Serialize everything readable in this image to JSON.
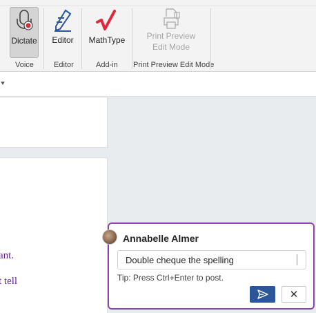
{
  "ribbon": {
    "buttons": {
      "dictate": "Dictate",
      "editor": "Editor",
      "mathtype": "MathType",
      "print_preview_line1": "Print Preview",
      "print_preview_line2": "Edit Mode"
    },
    "groups": {
      "voice": "Voice",
      "editor": "Editor",
      "addin": "Add-in",
      "print_preview": "Print Preview Edit Mode"
    }
  },
  "document": {
    "line1": "ant.",
    "line2": "t tell"
  },
  "comment": {
    "author": "Annabelle Almer",
    "input_value": "Double cheque the spelling",
    "tip": "Tip: Press Ctrl+Enter to post."
  },
  "colors": {
    "accent": "#2b579a",
    "comment_border": "#8e44ad",
    "doc_text": "#6a1fa3"
  }
}
